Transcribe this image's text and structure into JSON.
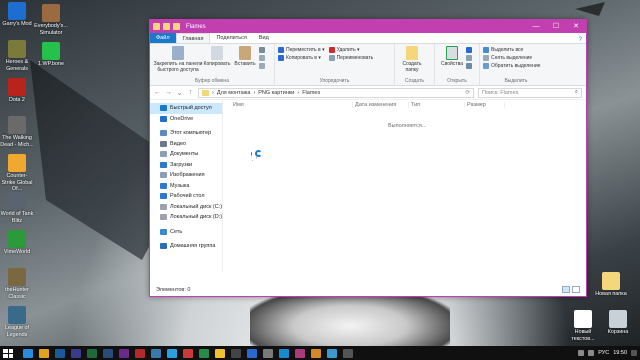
{
  "desktop": {
    "icons_left": [
      {
        "label": "Garry's Mod",
        "color": "#1c6fd1"
      },
      {
        "label": "Heroes & Generals",
        "color": "#7a7a3a"
      },
      {
        "label": "Dota 2",
        "color": "#b8241c"
      },
      {
        "label": "The Walking Dead - Mich...",
        "color": "#6a6a6a"
      },
      {
        "label": "Counter-Strike Global Of...",
        "color": "#f0a830"
      },
      {
        "label": "World of Tank Blitz",
        "color": "#5a6470"
      },
      {
        "label": "VimeWorld",
        "color": "#2a9a3a"
      },
      {
        "label": "theHunter Classic",
        "color": "#7a6840"
      },
      {
        "label": "League of Legends",
        "color": "#3a6a8a"
      }
    ],
    "icons_col2": [
      {
        "label": "Everybody's... Simulator",
        "color": "#9a6a40"
      },
      {
        "label": "1.WP.bone",
        "color": "#24c24a"
      }
    ],
    "icons_right": [
      {
        "label": "Новая папка",
        "color": "#f5d67b"
      },
      {
        "label": "Новый текстов...",
        "color": "#ffffff"
      },
      {
        "label": "Корзина",
        "color": "#c8d0d8"
      }
    ],
    "window_under_label": "монтажа"
  },
  "window": {
    "title": "Flames",
    "controls": [
      "—",
      "☐",
      "✕"
    ],
    "tabs": {
      "file": "Файл",
      "home": "Главная",
      "share": "Поделиться",
      "view": "Вид"
    },
    "help": "?",
    "ribbon": {
      "pin": "Закрепить на панели быстрого доступа",
      "copy": "Копировать",
      "paste": "Вставить",
      "clipboard_group": "Буфер обмена",
      "move_to": "Переместить в ▾",
      "copy_to": "Копировать в ▾",
      "delete": "Удалить ▾",
      "rename": "Переименовать",
      "organize_group": "Упорядочить",
      "new_folder": "Создать папку",
      "create_group": "Создать",
      "properties": "Свойства",
      "open_group": "Открыть",
      "select_all": "Выделить все",
      "select_none": "Снять выделение",
      "invert": "Обратить выделение",
      "select_group": "Выделить"
    },
    "nav": {
      "back": "←",
      "forward": "→",
      "up": "↑",
      "recent": "⌄"
    },
    "breadcrumb": [
      "Для монтажа",
      "PNG картинки",
      "Flames"
    ],
    "search_placeholder": "Поиск: Flames",
    "nav_items": [
      {
        "label": "Быстрый доступ",
        "color": "#1979ca",
        "sel": true
      },
      {
        "label": "OneDrive",
        "color": "#1f6fcf"
      },
      {
        "label": "Этот компьютер",
        "color": "#5a8ac0",
        "gap": true
      },
      {
        "label": "Видео",
        "color": "#6a7a8a"
      },
      {
        "label": "Документы",
        "color": "#8aa0b8"
      },
      {
        "label": "Загрузки",
        "color": "#2a7ad0"
      },
      {
        "label": "Изображения",
        "color": "#8aa0b8"
      },
      {
        "label": "Музыка",
        "color": "#2a7ad0"
      },
      {
        "label": "Рабочий стол",
        "color": "#2a7ad0"
      },
      {
        "label": "Локальный диск (C:)",
        "color": "#9aa4ae"
      },
      {
        "label": "Локальный диск (D:)",
        "color": "#9aa4ae"
      },
      {
        "label": "Сеть",
        "color": "#3a8ad0",
        "gap": true
      },
      {
        "label": "Домашняя группа",
        "color": "#2a6ac0",
        "gap": true
      }
    ],
    "columns": [
      "Имя",
      "Дата изменения",
      "Тип",
      "Размер"
    ],
    "working": "Выполняется...",
    "status": "Элементов: 0"
  },
  "taskbar": {
    "apps": [
      "#2a8ae0",
      "#e0a020",
      "#1a5a9a",
      "#3a3a8a",
      "#1e6a3a",
      "#2a4a7a",
      "#6a2a8a",
      "#b02a2a",
      "#3a7aaa",
      "#2aa0e0",
      "#c83a3a",
      "#2a8a4a",
      "#f0c030",
      "#444",
      "#2a6ad0",
      "#7a7a7a",
      "#1a8ad0",
      "#aa3a7a",
      "#d08a2a",
      "#3a9ad0",
      "#555"
    ],
    "lang": "РУС",
    "time": "19:50"
  }
}
